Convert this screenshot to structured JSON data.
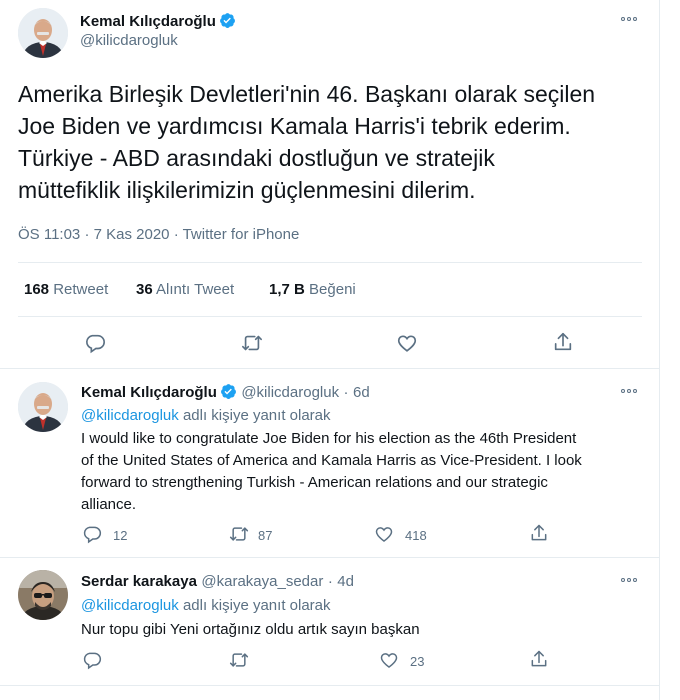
{
  "main_tweet": {
    "author_name": "Kemal Kılıçdaroğlu",
    "author_handle": "@kilicdarogluk",
    "text_lines": [
      "Amerika Birleşik Devletleri'nin 46. Başkanı olarak seçilen",
      "Joe Biden ve yardımcısı Kamala Harris'i tebrik ederim.",
      "Türkiye - ABD arasındaki dostluğun ve stratejik",
      "müttefiklik ilişkilerimizin güçlenmesini dilerim."
    ],
    "time": "ÖS 11:03",
    "date": "7 Kas 2020",
    "source": "Twitter for iPhone",
    "separator": "·",
    "stats": {
      "retweets_count": "168",
      "retweets_label": "Retweet",
      "quotes_count": "36",
      "quotes_label": "Alıntı Tweet",
      "likes_count": "1,7 B",
      "likes_label": "Beğeni"
    },
    "actions": [
      "reply-icon",
      "retweet-icon",
      "like-icon",
      "share-icon"
    ]
  },
  "replies": [
    {
      "author_name": "Kemal Kılıçdaroğlu",
      "verified": true,
      "author_handle": "@kilicdarogluk",
      "age": "6d",
      "replying_to_handle": "@kilicdarogluk",
      "replying_to_suffix": "adlı kişiye yanıt olarak",
      "text_lines": [
        "I would like to congratulate Joe Biden for his election as the 46th President",
        "of the United States of America and Kamala Harris as Vice-President. I look",
        "forward to strengthening Turkish - American relations and our strategic",
        "alliance."
      ],
      "reply_count": "12",
      "retweet_count": "87",
      "like_count": "418"
    },
    {
      "author_name": "Serdar karakaya",
      "verified": false,
      "author_handle": "@karakaya_sedar",
      "age": "4d",
      "replying_to_handle": "@kilicdarogluk",
      "replying_to_suffix": "adlı kişiye yanıt olarak",
      "text_lines": [
        "Nur topu gibi Yeni ortağınız oldu artık sayın başkan"
      ],
      "reply_count": "",
      "retweet_count": "",
      "like_count": "23"
    }
  ],
  "colors": {
    "text": "#0f1419",
    "secondary": "#5b7083",
    "link": "#1b95e0",
    "verified": "#1da1f2",
    "divider": "#e6ecf0"
  }
}
